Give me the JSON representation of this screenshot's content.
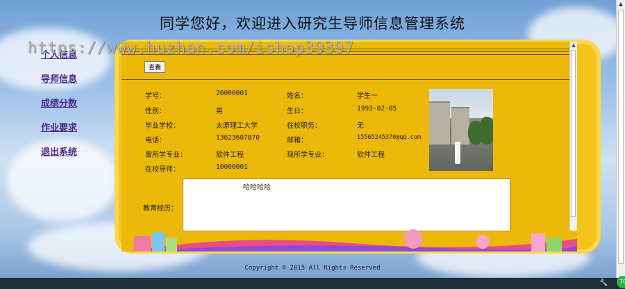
{
  "page": {
    "title": "同学您好，欢迎进入研究生导师信息管理系统"
  },
  "watermark": "https://www.huzhan.com/ishop39397",
  "nav": {
    "items": [
      "个人信息",
      "导师信息",
      "成绩分数",
      "作业要求",
      "退出系统"
    ]
  },
  "toolbar": {
    "view_label": "查看"
  },
  "profile": {
    "student_id_label": "学号：",
    "student_id": "20000001",
    "name_label": "姓名：",
    "name": "学生一",
    "gender_label": "性别：",
    "gender": "男",
    "birthday_label": "生日：",
    "birthday": "1993-02-05",
    "school_label": "毕业学校：",
    "school": "太原理工大学",
    "position_label": "在校职务：",
    "position": "无",
    "phone_label": "电话：",
    "phone": "13623607870",
    "email_label": "邮箱：",
    "email": "15565245370@qq.com",
    "prev_major_label": "曾所学专业：",
    "prev_major": "软件工程",
    "curr_major_label": "现所学专业：",
    "curr_major": "软件工程",
    "advisor_label": "在校导师：",
    "advisor": "10000001",
    "education_label": "教育经历：",
    "education": "哈哈哈哈"
  },
  "footer": {
    "copyright": "Copyright © 2015 All Rights Reserved"
  },
  "icons": {
    "taskbar_tool": "wrench-icon",
    "taskbar_badge": "green-badge-icon"
  }
}
